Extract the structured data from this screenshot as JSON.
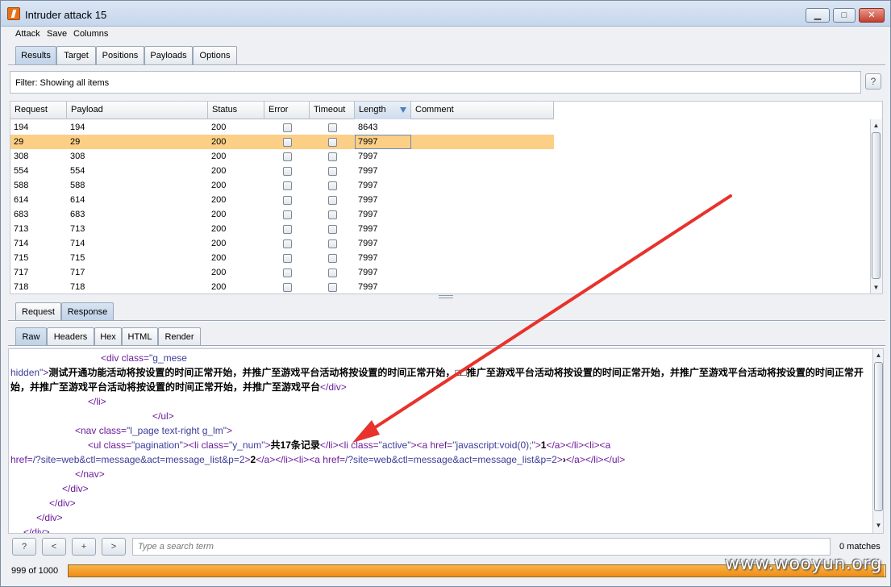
{
  "window": {
    "title": "Intruder attack 15"
  },
  "menu": [
    "Attack",
    "Save",
    "Columns"
  ],
  "tabs": [
    "Results",
    "Target",
    "Positions",
    "Payloads",
    "Options"
  ],
  "filter": {
    "text": "Filter: Showing all items",
    "help": "?"
  },
  "table": {
    "headers": [
      "Request",
      "Payload",
      "Status",
      "Error",
      "Timeout",
      "Length",
      "Comment"
    ],
    "sorted_column": "Length",
    "rows": [
      {
        "request": "194",
        "payload": "194",
        "status": "200",
        "length": "8643"
      },
      {
        "request": "29",
        "payload": "29",
        "status": "200",
        "length": "7997",
        "selected": true
      },
      {
        "request": "308",
        "payload": "308",
        "status": "200",
        "length": "7997"
      },
      {
        "request": "554",
        "payload": "554",
        "status": "200",
        "length": "7997"
      },
      {
        "request": "588",
        "payload": "588",
        "status": "200",
        "length": "7997"
      },
      {
        "request": "614",
        "payload": "614",
        "status": "200",
        "length": "7997"
      },
      {
        "request": "683",
        "payload": "683",
        "status": "200",
        "length": "7997"
      },
      {
        "request": "713",
        "payload": "713",
        "status": "200",
        "length": "7997"
      },
      {
        "request": "714",
        "payload": "714",
        "status": "200",
        "length": "7997"
      },
      {
        "request": "715",
        "payload": "715",
        "status": "200",
        "length": "7997"
      },
      {
        "request": "717",
        "payload": "717",
        "status": "200",
        "length": "7997"
      },
      {
        "request": "718",
        "payload": "718",
        "status": "200",
        "length": "7997"
      }
    ]
  },
  "message_tabs": [
    "Request",
    "Response"
  ],
  "view_tabs": [
    "Raw",
    "Headers",
    "Hex",
    "HTML",
    "Render"
  ],
  "code": {
    "l1_tag": "<div class=",
    "l1_val": "\"g_mese",
    "l2_val": "hidden\"",
    "l2_tag": ">",
    "l2_text": "测试开通功能活动将按设置的时间正常开始，并推广至游戏平台活动将按设置的时间正常开始，□□推广至游戏平台活动将按设置的时间正常开始，并推广至游戏平台活动将按设置的时间正常开始，并推广至游戏平台活动将按设置的时间正常开始，并推广至游戏平台",
    "l2_close": "</div>",
    "l3": "</li>",
    "l4": "</ul>",
    "l5_tag": "<nav class=",
    "l5_val": "\"l_page text-right g_lm\"",
    "l5_end": ">",
    "l6_a": "<ul class=",
    "l6_b": "\"pagination\"",
    "l6_c": "><li class=",
    "l6_d": "\"y_num\"",
    "l6_e": ">",
    "l6_text": "共17条记录",
    "l6_f": "</li><li class=",
    "l6_g": "\"active\"",
    "l6_h": "><a href=",
    "l6_i": "\"javascript:void(0);\"",
    "l6_j": ">",
    "l6_k": "1",
    "l6_l": "</a></li><li><a",
    "l7_a": "href=",
    "l7_b": "/?site=web&ctl=message&act=message_list&p=2",
    "l7_c": ">",
    "l7_d": "2",
    "l7_e": "</a></li><li><a href=",
    "l7_f": "/?site=web&ctl=message&act=message_list&p=2",
    "l7_g": ">",
    "l7_h": "›",
    "l7_i": "</a></li></ul>",
    "l8": "</nav>",
    "l9": "</div>",
    "l10": "</div>",
    "l11": "</div>",
    "l12": "</div>"
  },
  "search": {
    "placeholder": "Type a search term",
    "buttons": [
      "?",
      "<",
      "+",
      ">"
    ],
    "matches": "0 matches"
  },
  "progress": {
    "label": "999 of 1000",
    "value": 0.999
  },
  "watermark": "www.wooyun.org",
  "colors": {
    "selected_row": "#fbcf86",
    "progress": "#f08c14",
    "arrow": "#e8322c"
  }
}
